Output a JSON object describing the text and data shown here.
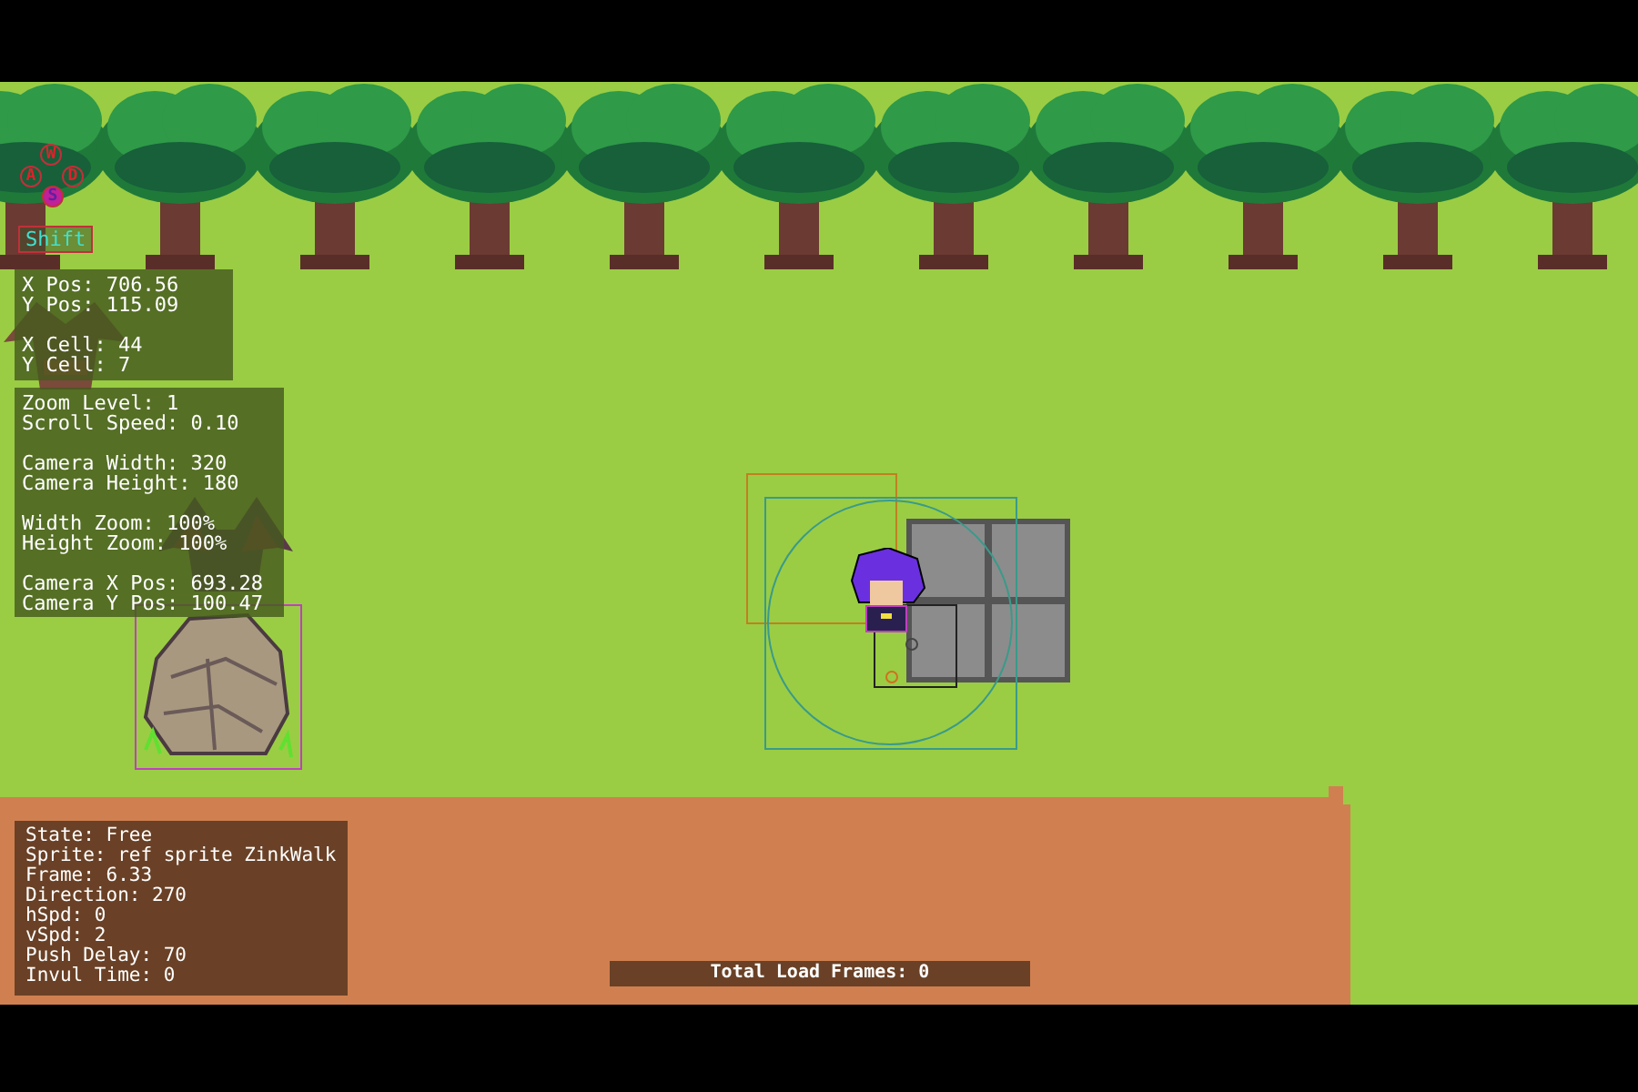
{
  "keys": [
    {
      "label": "W",
      "pressed": false
    },
    {
      "label": "A",
      "pressed": false
    },
    {
      "label": "D",
      "pressed": false
    },
    {
      "label": "S",
      "pressed": true
    }
  ],
  "modifier_key": {
    "label": "Shift"
  },
  "position_panel": {
    "groups": [
      [
        "X Pos: 706.56",
        "Y Pos: 115.09"
      ],
      [
        "X Cell: 44",
        "Y Cell: 7"
      ]
    ]
  },
  "camera_panel": {
    "groups": [
      [
        "Zoom Level: 1",
        "Scroll Speed: 0.10"
      ],
      [
        "Camera Width: 320",
        "Camera Height: 180"
      ],
      [
        "Width Zoom: 100%",
        "Height Zoom: 100%"
      ],
      [
        "Camera X Pos: 693.28",
        "Camera Y Pos: 100.47"
      ]
    ]
  },
  "state_panel": {
    "lines": [
      "State: Free",
      "Sprite: ref sprite ZinkWalk",
      "Frame: 6.33",
      "Direction: 270",
      "hSpd: 0",
      "vSpd: 2",
      "Push Delay: 70",
      "Invul Time: 0"
    ]
  },
  "load_bar": {
    "text": "Total Load Frames: 0"
  }
}
